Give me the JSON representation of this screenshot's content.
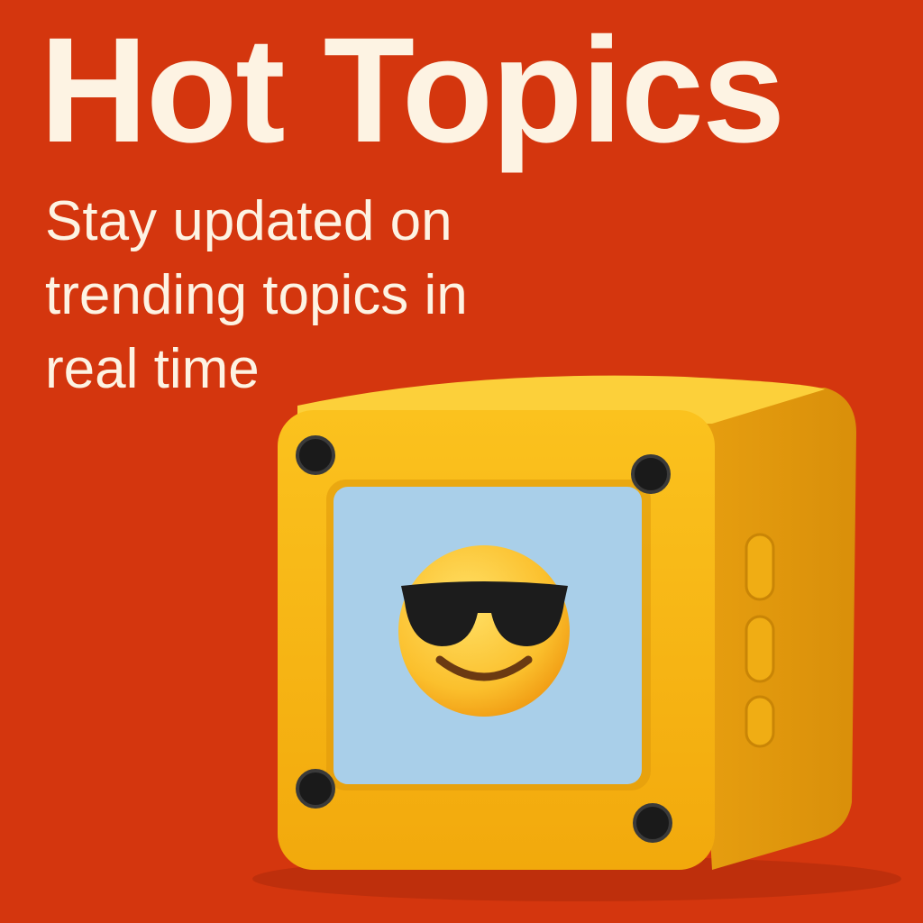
{
  "headline": "Hot Topics",
  "subtitle_lines": [
    "Stay updated on",
    "trending topics in",
    "real time"
  ],
  "colors": {
    "background": "#d4360e",
    "text": "#fdf3e3",
    "device": "#f5b511",
    "screen": "#a9cfe9"
  },
  "device": {
    "screen_icon": "smiling-face-with-sunglasses-emoji",
    "side_buttons": 3
  }
}
